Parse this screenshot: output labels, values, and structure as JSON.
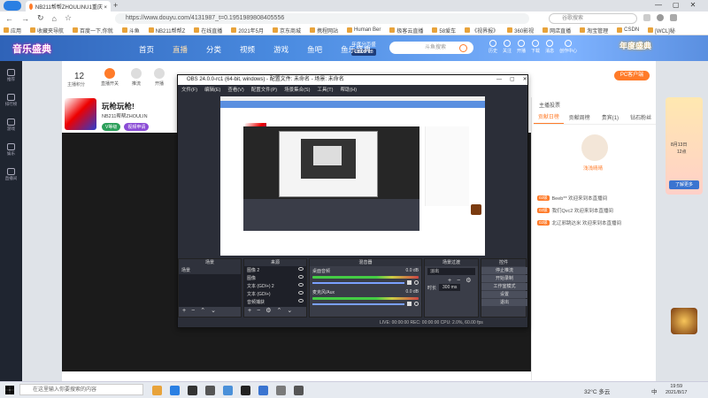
{
  "browser": {
    "tab_title": "NB211帮帮ZHOULINU1重庆 ×",
    "new_tab": "+",
    "url": "https://www.douyu.com/4131987_t=0.1951989808405556",
    "search_placeholder": "谷歌搜索",
    "bookmarks": [
      "应用",
      "收藏夹导航",
      "百度一下,你就",
      "斗鱼",
      "NB211帮帮Z",
      "在线直播",
      "2021年5月",
      "京东商城",
      "携程网站",
      "Human Ber",
      "极客云直播",
      "58爱车",
      "《视界报》",
      "360影视",
      "网店直播",
      "淘宝管理",
      "CSDN",
      "[WCL]秘"
    ]
  },
  "douyu": {
    "logo_text": "音乐盛典",
    "nav": [
      "首页",
      "直播",
      "分类",
      "视频",
      "游戏",
      "鱼吧",
      "鱼乐盛典"
    ],
    "countdown_label": "年度分页盛",
    "countdown_value": "16:00:28",
    "search_placeholder": "斗鱼搜索",
    "user_links": [
      "历史",
      "关注",
      "开播",
      "下载",
      "消息",
      "创作中心"
    ],
    "right_banner": "年度盛典",
    "left_menu": [
      "推荐",
      "排行榜",
      "游戏",
      "娱乐",
      "直播间",
      "登录"
    ],
    "stats_number": "12",
    "stats_label": "主播积分",
    "stat_items": [
      "直播开关",
      "推流",
      "开播"
    ],
    "streamer_title": "玩枪玩枪!",
    "streamer_name": "NB211帮帮ZHOULIN",
    "streamer_tags": [
      "V等级",
      "视频申请"
    ],
    "pc_button": "PC客户端",
    "right_tabs": [
      "贡献日榜",
      "贡献周榜",
      "贵宾(1)",
      "钻石粉丝"
    ],
    "host_panel": "主播投票",
    "host_name": "浅浅晴晴",
    "chat_lines": [
      {
        "badge": "02级",
        "text": "Beeb** 欢迎来到本直播间"
      },
      {
        "badge": "02级",
        "text": "我们Qvc2 欢迎来到本直播间"
      },
      {
        "badge": "02级",
        "text": "北辽邪跳达米 欢迎来到本直播间"
      }
    ],
    "promo_date": "8月13日",
    "promo_sub": "12点",
    "promo_button": "了解更多"
  },
  "obs": {
    "title": "OBS 24.0.0-rc1 (64-bit, windows) - 配置文件: 未命名 - 场景: 未命名",
    "menu": [
      "文件(F)",
      "编辑(E)",
      "查看(V)",
      "配置文件(P)",
      "场景集合(S)",
      "工具(T)",
      "帮助(H)"
    ],
    "docks": {
      "scenes": {
        "header": "场景",
        "items": [
          "场景"
        ]
      },
      "sources": {
        "header": "来源",
        "items": [
          "图像 2",
          "图像",
          "文本 (GDI+) 2",
          "文本 (GDI+)",
          "音频捕获",
          "窗口捕获"
        ]
      },
      "mixer": {
        "header": "混音器",
        "channels": [
          {
            "name": "桌面音频",
            "db": "0.0 dB"
          },
          {
            "name": "麦克风/Aux",
            "db": "0.0 dB"
          }
        ]
      },
      "transitions": {
        "header": "场景过渡",
        "type": "淡出",
        "duration_label": "时长",
        "duration_value": "300 ms"
      },
      "controls": {
        "header": "控件",
        "buttons": [
          "停止推流",
          "开始录制",
          "工作室模式",
          "设置",
          "退出"
        ]
      }
    },
    "status": "LIVE: 00:00:00   REC: 00:00:00   CPU: 2.0%, 60.00 fps"
  },
  "taskbar": {
    "search_placeholder": "在这里输入你要搜索的内容",
    "weather": "32°C 多云",
    "ime": "中",
    "time": "19:59",
    "date": "2021/8/17"
  },
  "colors": {
    "douyu_orange": "#ff7b29",
    "header_blue": "#3a74d0",
    "obs_bg": "#2b2e38"
  }
}
